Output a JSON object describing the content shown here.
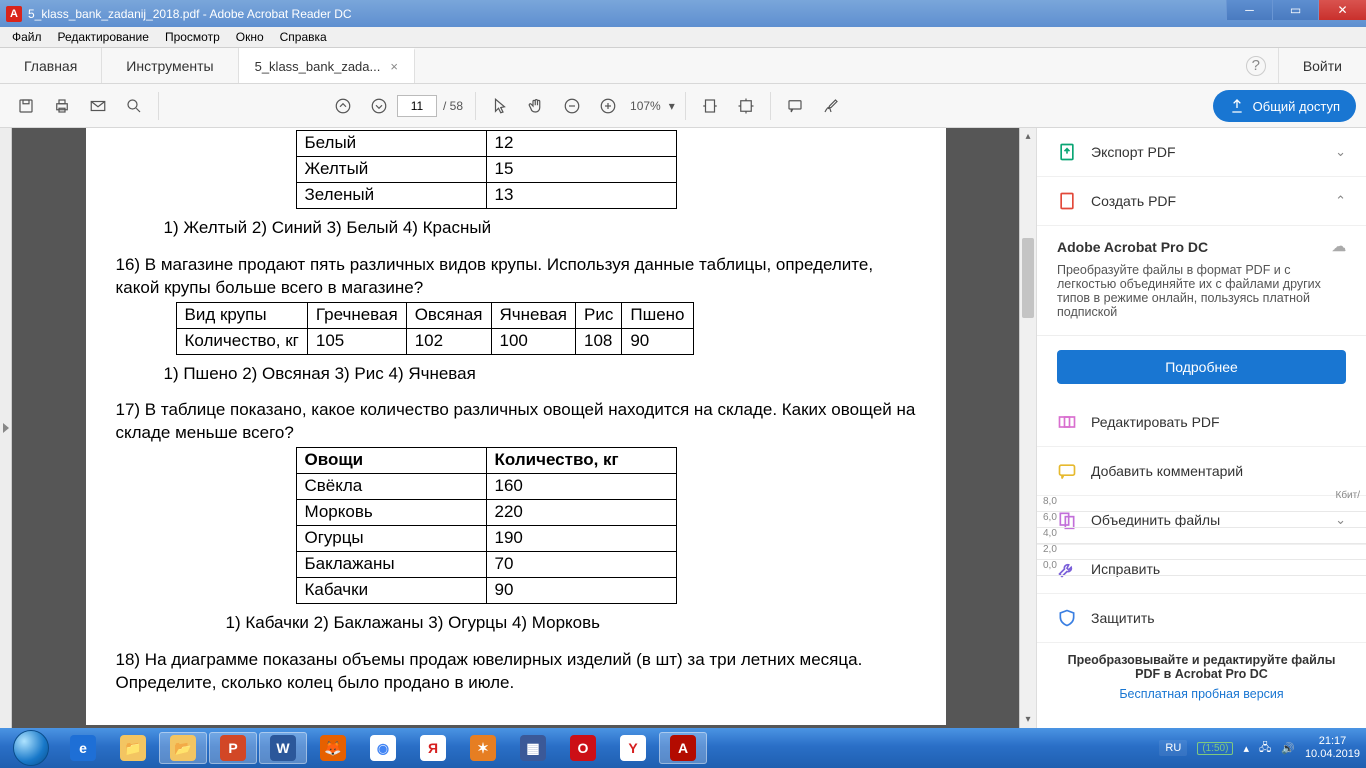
{
  "window": {
    "title": "5_klass_bank_zadanij_2018.pdf - Adobe Acrobat Reader DC"
  },
  "menu": {
    "file": "Файл",
    "edit": "Редактирование",
    "view": "Просмотр",
    "window": "Окно",
    "help": "Справка"
  },
  "tabs": {
    "home": "Главная",
    "tools": "Инструменты",
    "doc": "5_klass_bank_zada...",
    "login": "Войти"
  },
  "toolbar": {
    "page": "11",
    "total": "/ 58",
    "zoom": "107%",
    "share": "Общий доступ"
  },
  "doc": {
    "table1": {
      "rows": [
        [
          "Белый",
          "12"
        ],
        [
          "Желтый",
          "15"
        ],
        [
          "Зеленый",
          "13"
        ]
      ]
    },
    "q15_opts": "1)  Желтый    2) Синий     3)   Белый      4) Красный",
    "q16_text": "16)  В магазине продают пять различных видов крупы. Используя данные таблицы, определите, какой крупы больше всего в магазине?",
    "table2": {
      "h": [
        "Вид крупы",
        "Гречневая",
        "Овсяная",
        "Ячневая",
        "Рис",
        "Пшено"
      ],
      "r": [
        "Количество, кг",
        "105",
        "102",
        "100",
        "108",
        "90"
      ]
    },
    "q16_opts": "1)  Пшено     2)  Овсяная    3)   Рис        4) Ячневая",
    "q17_text": "17)  В таблице показано, какое количество различных овощей находится на складе. Каких овощей на складе меньше всего?",
    "table3": {
      "h": [
        "Овощи",
        "Количество, кг"
      ],
      "rows": [
        [
          "Свёкла",
          "160"
        ],
        [
          "Морковь",
          "220"
        ],
        [
          "Огурцы",
          "190"
        ],
        [
          "Баклажаны",
          "70"
        ],
        [
          "Кабачки",
          "90"
        ]
      ]
    },
    "q17_opts": "1) Кабачки    2) Баклажаны     3)   Огурцы      4) Морковь",
    "q18_text": "18)  На диаграмме показаны объемы продаж ювелирных изделий (в шт) за три летних месяца. Определите, сколько колец было продано в июле."
  },
  "sidebar": {
    "export": "Экспорт PDF",
    "create": "Создать PDF",
    "pro_hd": "Adobe Acrobat Pro DC",
    "pro_desc": "Преобразуйте файлы в формат PDF и с легкостью объединяйте их с файлами других типов в режиме онлайн, пользуясь платной подпиской",
    "more": "Подробнее",
    "edit": "Редактировать PDF",
    "comment": "Добавить комментарий",
    "combine": "Объединить файлы",
    "fix": "Исправить",
    "protect": "Защитить",
    "promo1": "Преобразовывайте и редактируйте файлы PDF в Acrobat Pro DC",
    "promo2": "Бесплатная пробная версия",
    "kbit": "Кбит/",
    "ticks": [
      "8,0",
      "6,0",
      "4,0",
      "2,0",
      "0,0"
    ]
  },
  "tray": {
    "lang": "RU",
    "batt": "(1:50)",
    "time": "21:17",
    "date": "10.04.2019"
  }
}
